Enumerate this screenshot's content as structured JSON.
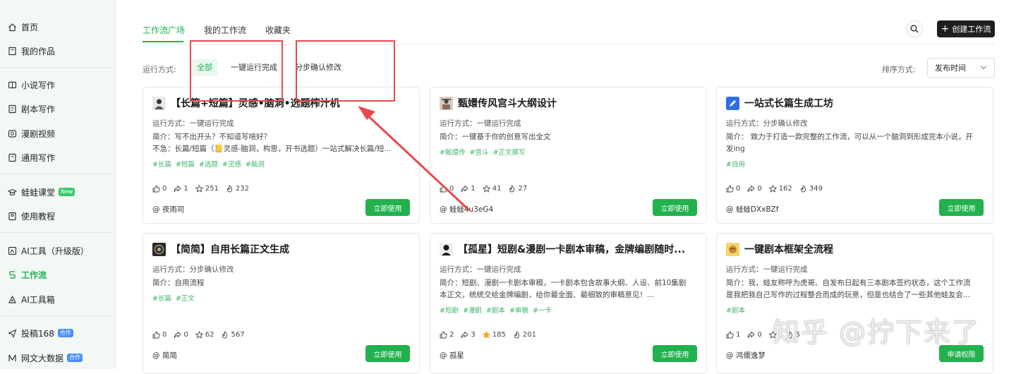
{
  "sidebar": {
    "items": [
      {
        "label": "首页",
        "icon": "home-icon"
      },
      {
        "label": "我的作品",
        "icon": "book-icon"
      },
      {
        "label": "小说写作",
        "icon": "open-book-icon"
      },
      {
        "label": "剧本写作",
        "icon": "script-icon"
      },
      {
        "label": "漫剧视频",
        "icon": "video-icon"
      },
      {
        "label": "通用写作",
        "icon": "doc-icon"
      },
      {
        "label": "蛙蛙课堂",
        "icon": "graduation-icon",
        "badge": "New"
      },
      {
        "label": "使用教程",
        "icon": "help-icon"
      },
      {
        "label": "AI工具（升级版）",
        "icon": "tool-icon"
      },
      {
        "label": "工作流",
        "icon": "workflow-icon"
      },
      {
        "label": "AI工具箱",
        "icon": "toolbox-icon"
      },
      {
        "label": "投稿168",
        "icon": "send-icon",
        "badge": "合作"
      },
      {
        "label": "网文大数据",
        "icon": "data-icon",
        "badge": "合作"
      }
    ]
  },
  "tabs": [
    "工作流广场",
    "我的工作流",
    "收藏夹"
  ],
  "create_label": "创建工作流",
  "filter": {
    "label": "运行方式:",
    "options": [
      "全部",
      "一键运行完成",
      "分步确认修改"
    ]
  },
  "sort": {
    "label": "排序方式:",
    "value": "发布时间"
  },
  "cards": [
    {
      "title": "【长篇+短篇】灵感•脑洞•选题榨汁机",
      "mode": "运行方式：一键运行完成",
      "desc": [
        "简介：写不出开头？不知道写啥好？",
        "不急：长篇/短篇（📒灵感-脑洞，构思，开书选题）一站式解决长篇/短..."
      ],
      "tags": [
        "#长篇",
        "#短篇",
        "#选题",
        "#灵感",
        "#脑洞"
      ],
      "likes": "0",
      "shares": "1",
      "stars": "251",
      "uses": "232",
      "author": "@ 夜雨司",
      "button": "立即使用"
    },
    {
      "title": "甄嬛传风宫斗大纲设计",
      "mode": "运行方式：一键运行完成",
      "desc": [
        "简介：一键基于你的创意写出全文"
      ],
      "tags": [
        "#甄嬛传",
        "#宫斗",
        "#正文撰写"
      ],
      "likes": "0",
      "shares": "1",
      "stars": "41",
      "uses": "27",
      "author": "@ 蛙蛙4u3eG4",
      "button": "立即使用"
    },
    {
      "title": "一站式长篇生成工坊",
      "mode": "运行方式：分步确认修改",
      "desc": [
        "简介： 致力于打造一款完整的工作流，可以从一个脑洞到形成完本小说，开",
        "发ing"
      ],
      "tags": [
        "#自用"
      ],
      "likes": "0",
      "shares": "0",
      "stars": "162",
      "uses": "349",
      "author": "@ 蛙蛙DXxBZf",
      "button": "立即使用"
    },
    {
      "title": "【简简】自用长篇正文生成",
      "mode": "运行方式：分步确认修改",
      "desc": [
        "简介：自用流程"
      ],
      "tags": [
        "#长篇",
        "#正文"
      ],
      "likes": "0",
      "shares": "0",
      "stars": "62",
      "uses": "567",
      "author": "@ 简简",
      "button": "立即使用"
    },
    {
      "title": "【孤星】短剧&漫剧一卡剧本审稿，金牌编剧随时...",
      "mode": "运行方式：一键运行完成",
      "desc": [
        "简介：短剧、漫剧一卡剧本审稿，一卡剧本包含故事大纲、人设、前10集剧",
        "本正文，统统交给金牌编剧，给你最全面、最细致的审稿意见！..."
      ],
      "tags": [
        "#短剧",
        "#漫剧",
        "#剧本",
        "#审稿",
        "#一卡"
      ],
      "likes": "2",
      "shares": "3",
      "stars": "185",
      "uses": "201",
      "author": "@ 孤星",
      "button": "立即使用"
    },
    {
      "title": "一键剧本框架全流程",
      "mode": "运行方式：一键运行完成",
      "desc": [
        "简介：我，蛙友称呼为虎哥。自发布日起有三本剧本签约状态，这个工作流",
        "是我把我自己写作的过程整合而成的玩意，但是也结合了一些其他蛙友会..."
      ],
      "tags": [
        "#剧本"
      ],
      "likes": "1",
      "shares": "0",
      "stars": "",
      "uses": "5",
      "author": "@ 鸿儒逸梦",
      "button": "申请权限"
    }
  ],
  "watermark": "知乎 @拧下来了",
  "colors": {
    "accent": "#22b14c",
    "annotation": "#e8494b"
  }
}
